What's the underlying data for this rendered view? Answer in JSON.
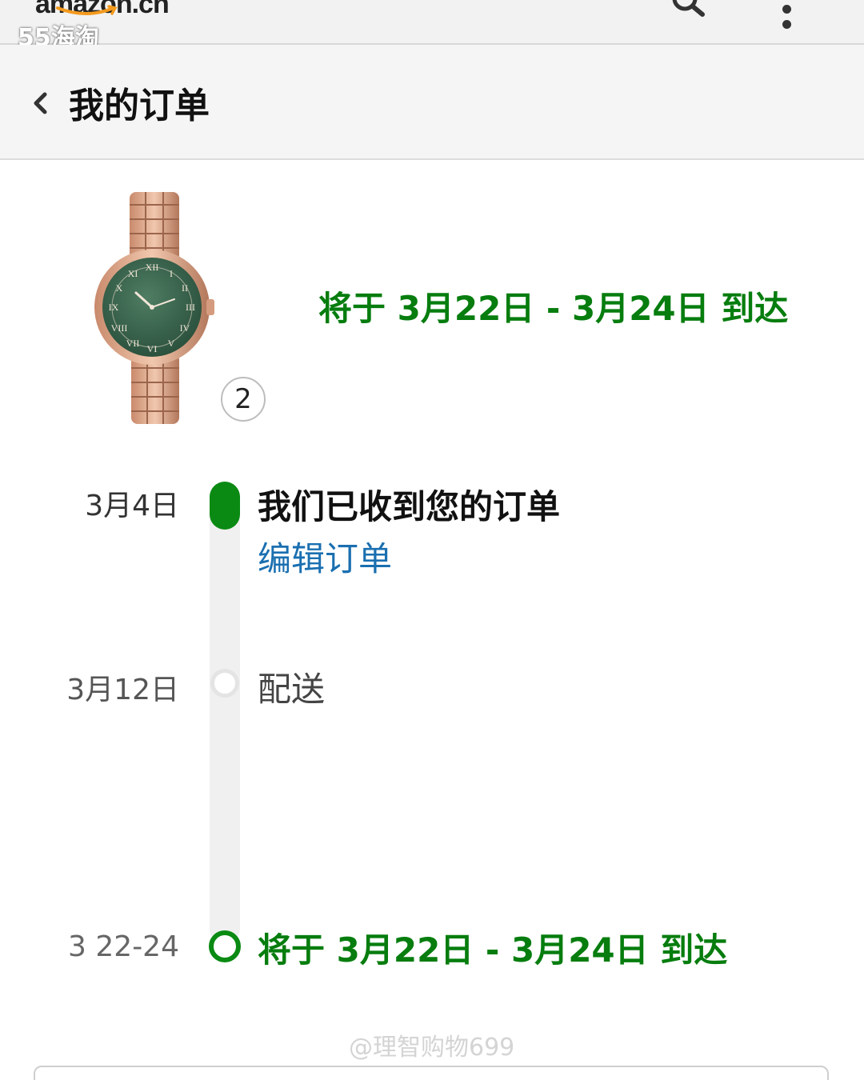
{
  "topbar": {
    "logo_text": "amazon.cn",
    "watermark": "55海淘",
    "icons": [
      "search-icon",
      "more-icon"
    ]
  },
  "header": {
    "back_icon": "chevron-left-icon",
    "title": "我的订单"
  },
  "product": {
    "image": "watch-product-image",
    "quantity": "2",
    "delivery_estimate": "将于 3月22日 - 3月24日 到达"
  },
  "timeline": {
    "steps": [
      {
        "date": "3月4日",
        "title": "我们已收到您的订单",
        "action_label": "编辑订单",
        "status": "completed"
      },
      {
        "date": "3月12日",
        "title": "配送",
        "status": "pending"
      },
      {
        "date": "3 22-24",
        "title": "将于 3月22日 - 3月24日 到达",
        "status": "upcoming"
      }
    ]
  },
  "watermark_bottom": "@理智购物699",
  "colors": {
    "success_green": "#067d0e",
    "link_blue": "#1a6fb0",
    "track_gray": "#f0f0f0"
  }
}
